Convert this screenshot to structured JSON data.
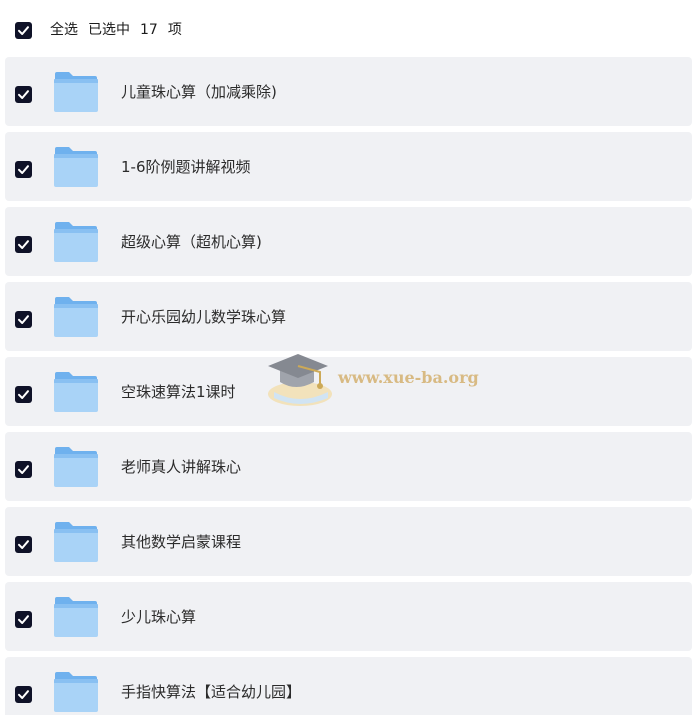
{
  "header": {
    "select_all_label": "全选",
    "selected_prefix": "已选中",
    "selected_count": "17",
    "selected_suffix": "项",
    "select_all_checked": true
  },
  "items": [
    {
      "label": "儿童珠心算（加减乘除)",
      "checked": true,
      "icon": "folder-icon"
    },
    {
      "label": "1-6阶例题讲解视频",
      "checked": true,
      "icon": "folder-icon"
    },
    {
      "label": "超级心算（超机心算)",
      "checked": true,
      "icon": "folder-icon"
    },
    {
      "label": "开心乐园幼儿数学珠心算",
      "checked": true,
      "icon": "folder-icon"
    },
    {
      "label": "空珠速算法1课时",
      "checked": true,
      "icon": "folder-icon"
    },
    {
      "label": "老师真人讲解珠心",
      "checked": true,
      "icon": "folder-icon"
    },
    {
      "label": "其他数学启蒙课程",
      "checked": true,
      "icon": "folder-icon"
    },
    {
      "label": "少儿珠心算",
      "checked": true,
      "icon": "folder-icon"
    },
    {
      "label": "手指快算法【适合幼儿园】",
      "checked": true,
      "icon": "folder-icon"
    }
  ],
  "watermark": {
    "text": "www.xue-ba.org",
    "icon": "graduation-cap-icon"
  },
  "colors": {
    "checkbox": "#0f1228",
    "row_background": "#f0f1f4",
    "folder_light": "#a9d3f7",
    "folder_dark": "#6fb1ee",
    "watermark_text": "#d6b67a"
  }
}
